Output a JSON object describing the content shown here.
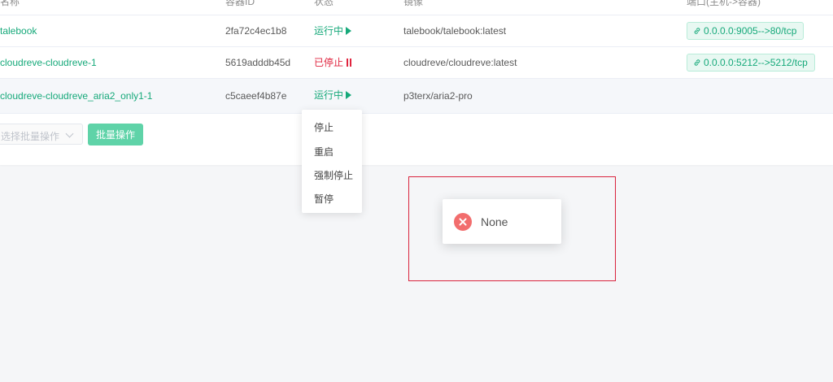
{
  "table": {
    "columns": [
      "名称",
      "容器ID",
      "状态",
      "镜像",
      "端口(主机->容器)"
    ],
    "rows": [
      {
        "name": "talebook",
        "container_id": "2fa72c4ec1b8",
        "status": "运行中",
        "image": "talebook/talebook:latest",
        "port": "0.0.0.0:9005-->80/tcp"
      },
      {
        "name": "cloudreve-cloudreve-1",
        "container_id": "5619adddb45d",
        "status": "已停止",
        "image": "cloudreve/cloudreve:latest",
        "port": "0.0.0.0:5212-->5212/tcp"
      },
      {
        "name": "cloudreve-cloudreve_aria2_only1-1",
        "container_id": "c5caeef4b87e",
        "status": "运行中",
        "image": "p3terx/aria2-pro",
        "port": ""
      }
    ]
  },
  "batch": {
    "select_placeholder": "选择批量操作",
    "button_label": "批量操作"
  },
  "dropdown": {
    "items": [
      "停止",
      "重启",
      "强制停止",
      "暂停"
    ]
  },
  "toast": {
    "message": "None"
  },
  "colors": {
    "accent": "#16a97a",
    "stopped": "#e0253f",
    "error_icon": "#f26d6d",
    "highlight_border": "#d9233d"
  },
  "icons": {
    "running": "play-icon",
    "stopped": "pause-icon",
    "port": "link-icon",
    "error": "error-circle-icon"
  }
}
